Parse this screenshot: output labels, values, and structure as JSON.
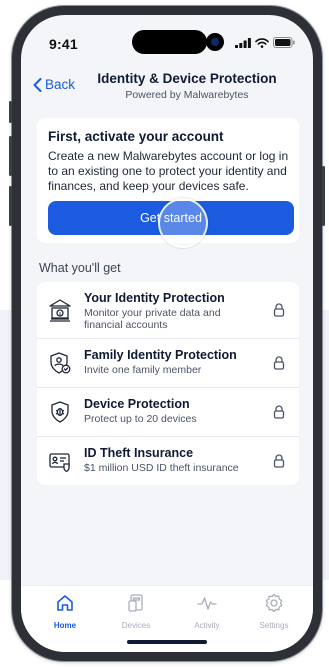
{
  "status_bar": {
    "time": "9:41"
  },
  "header": {
    "back_label": "Back",
    "title": "Identity & Device Protection",
    "subtitle": "Powered by Malwarebytes"
  },
  "activate_card": {
    "title": "First, activate your account",
    "body": "Create a new Malwarebytes account or log in to an existing one to protect your identity and finances, and keep your devices safe.",
    "button_label": "Get started"
  },
  "section_label": "What you'll get",
  "features": [
    {
      "icon": "bank-icon",
      "title": "Your Identity Protection",
      "description": "Monitor your private data and financial accounts"
    },
    {
      "icon": "family-shield-icon",
      "title": "Family Identity Protection",
      "description": "Invite one family member"
    },
    {
      "icon": "bug-shield-icon",
      "title": "Device Protection",
      "description": "Protect up to 20 devices"
    },
    {
      "icon": "id-card-icon",
      "title": "ID Theft Insurance",
      "description": "$1 million USD ID theft insurance"
    }
  ],
  "tabs": [
    {
      "icon": "home-icon",
      "label": "Home",
      "active": true
    },
    {
      "icon": "devices-icon",
      "label": "Devices",
      "active": false
    },
    {
      "icon": "activity-icon",
      "label": "Activity",
      "active": false
    },
    {
      "icon": "settings-icon",
      "label": "Settings",
      "active": false
    }
  ],
  "colors": {
    "accent": "#1a5be0",
    "text_dark": "#0f1a33",
    "screen_bg": "#f4f5f9"
  }
}
